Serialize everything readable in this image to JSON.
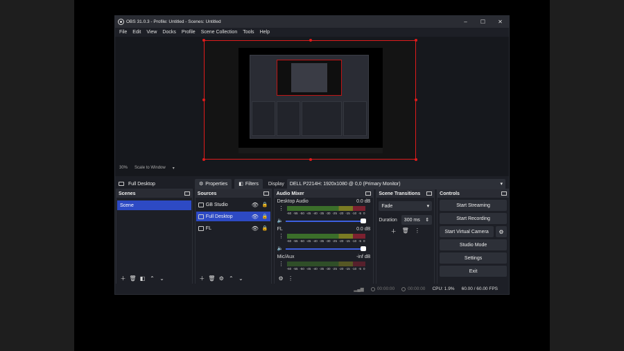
{
  "window": {
    "title": "OBS 31.0.3 - Profile: Untitled - Scenes: Untitled",
    "minimize": "–",
    "maximize": "☐",
    "close": "✕"
  },
  "menu": [
    "File",
    "Edit",
    "View",
    "Docks",
    "Profile",
    "Scene Collection",
    "Tools",
    "Help"
  ],
  "preview": {
    "zoom": "30%",
    "scale_mode": "Scale to Window"
  },
  "context_bar": {
    "source_name": "Full Desktop",
    "properties_label": "Properties",
    "filters_label": "Filters",
    "display_label": "Display",
    "display_value": "DELL P2214H: 1920x1080 @ 0,0 (Primary Monitor)"
  },
  "scenes": {
    "title": "Scenes",
    "items": [
      "Scene"
    ]
  },
  "sources": {
    "title": "Sources",
    "items": [
      {
        "name": "GB Studio",
        "selected": false
      },
      {
        "name": "Full Desktop",
        "selected": true
      },
      {
        "name": "FL",
        "selected": false
      }
    ]
  },
  "audio_mixer": {
    "title": "Audio Mixer",
    "channels": [
      {
        "name": "Desktop Audio",
        "level": "0.0 dB"
      },
      {
        "name": "FL",
        "level": "0.0 dB"
      },
      {
        "name": "Mic/Aux",
        "level": "-inf dB"
      }
    ],
    "ticks": [
      "-60",
      "-55",
      "-50",
      "-45",
      "-40",
      "-35",
      "-30",
      "-25",
      "-20",
      "-15",
      "-10",
      "-5",
      "0"
    ]
  },
  "transitions": {
    "title": "Scene Transitions",
    "selected": "Fade",
    "duration_label": "Duration",
    "duration_value": "300 ms"
  },
  "controls": {
    "title": "Controls",
    "start_streaming": "Start Streaming",
    "start_recording": "Start Recording",
    "start_virtual_camera": "Start Virtual Camera",
    "studio_mode": "Studio Mode",
    "settings": "Settings",
    "exit": "Exit"
  },
  "status": {
    "stream_time": "00:00:00",
    "record_time": "00:00:00",
    "cpu": "CPU: 1.9%",
    "fps": "60.00 / 60.00 FPS"
  },
  "colors": {
    "selection": "#2d4ac4",
    "bounding_box": "#e01b1b",
    "slider": "#3d5fe0"
  }
}
